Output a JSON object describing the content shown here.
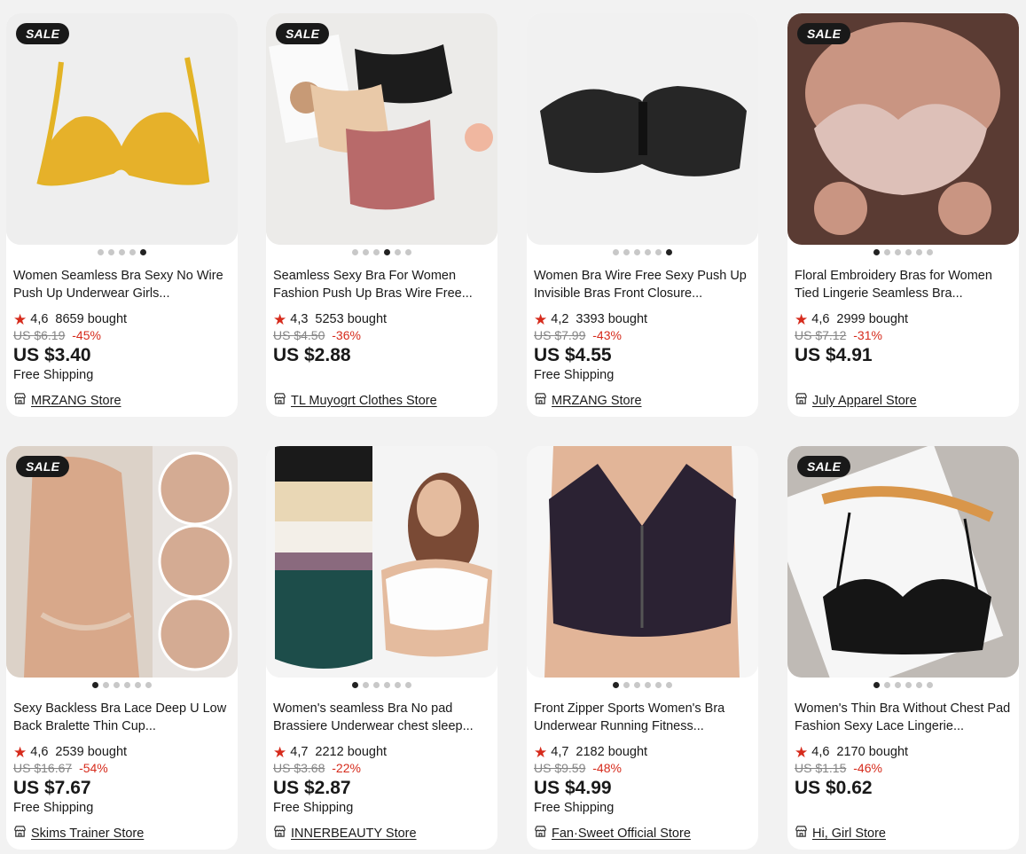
{
  "products": [
    {
      "badge": "SALE",
      "title": "Women Seamless Bra Sexy No Wire Push Up Underwear Girls...",
      "rating": "4,6",
      "sold": "8659 bought",
      "original_price": "US $6.19",
      "discount": "-45%",
      "price": "US $3.40",
      "shipping": "Free Shipping",
      "store": "MRZANG Store",
      "active_dot": 4,
      "dot_count": 5
    },
    {
      "badge": "SALE",
      "title": "Seamless Sexy Bra For Women Fashion Push Up Bras Wire Free...",
      "rating": "4,3",
      "sold": "5253 bought",
      "original_price": "US $4.50",
      "discount": "-36%",
      "price": "US $2.88",
      "shipping": "",
      "store": "TL Muyogrt Clothes Store",
      "active_dot": 3,
      "dot_count": 6
    },
    {
      "badge": "",
      "title": "Women Bra Wire Free Sexy Push Up Invisible Bras Front Closure...",
      "rating": "4,2",
      "sold": "3393 bought",
      "original_price": "US $7.99",
      "discount": "-43%",
      "price": "US $4.55",
      "shipping": "Free Shipping",
      "store": "MRZANG Store",
      "active_dot": 5,
      "dot_count": 6
    },
    {
      "badge": "SALE",
      "title": "Floral Embroidery Bras for Women Tied Lingerie Seamless Bra...",
      "rating": "4,6",
      "sold": "2999 bought",
      "original_price": "US $7.12",
      "discount": "-31%",
      "price": "US $4.91",
      "shipping": "",
      "store": "July Apparel Store",
      "active_dot": 0,
      "dot_count": 6
    },
    {
      "badge": "SALE",
      "title": "Sexy Backless Bra Lace Deep U Low Back Bralette Thin Cup...",
      "rating": "4,6",
      "sold": "2539 bought",
      "original_price": "US $16.67",
      "discount": "-54%",
      "price": "US $7.67",
      "shipping": "Free Shipping",
      "store": "Skims Trainer Store",
      "active_dot": 0,
      "dot_count": 6
    },
    {
      "badge": "",
      "title": "Women's seamless Bra No pad Brassiere Underwear chest sleep...",
      "rating": "4,7",
      "sold": "2212 bought",
      "original_price": "US $3.68",
      "discount": "-22%",
      "price": "US $2.87",
      "shipping": "Free Shipping",
      "store": "INNERBEAUTY Store",
      "active_dot": 0,
      "dot_count": 6
    },
    {
      "badge": "",
      "title": "Front Zipper Sports Women's Bra Underwear Running Fitness...",
      "rating": "4,7",
      "sold": "2182 bought",
      "original_price": "US $9.59",
      "discount": "-48%",
      "price": "US $4.99",
      "shipping": "Free Shipping",
      "store": "Fan·Sweet Official Store",
      "active_dot": 0,
      "dot_count": 6
    },
    {
      "badge": "SALE",
      "title": "Women's Thin Bra Without Chest Pad Fashion Sexy Lace Lingerie...",
      "rating": "4,6",
      "sold": "2170 bought",
      "original_price": "US $1.15",
      "discount": "-46%",
      "price": "US $0.62",
      "shipping": "",
      "store": "Hi, Girl Store",
      "active_dot": 0,
      "dot_count": 6
    }
  ],
  "colors": {
    "accent": "#d62b1c",
    "page_bg": "#f2f2f2",
    "badge_bg": "#191919"
  }
}
